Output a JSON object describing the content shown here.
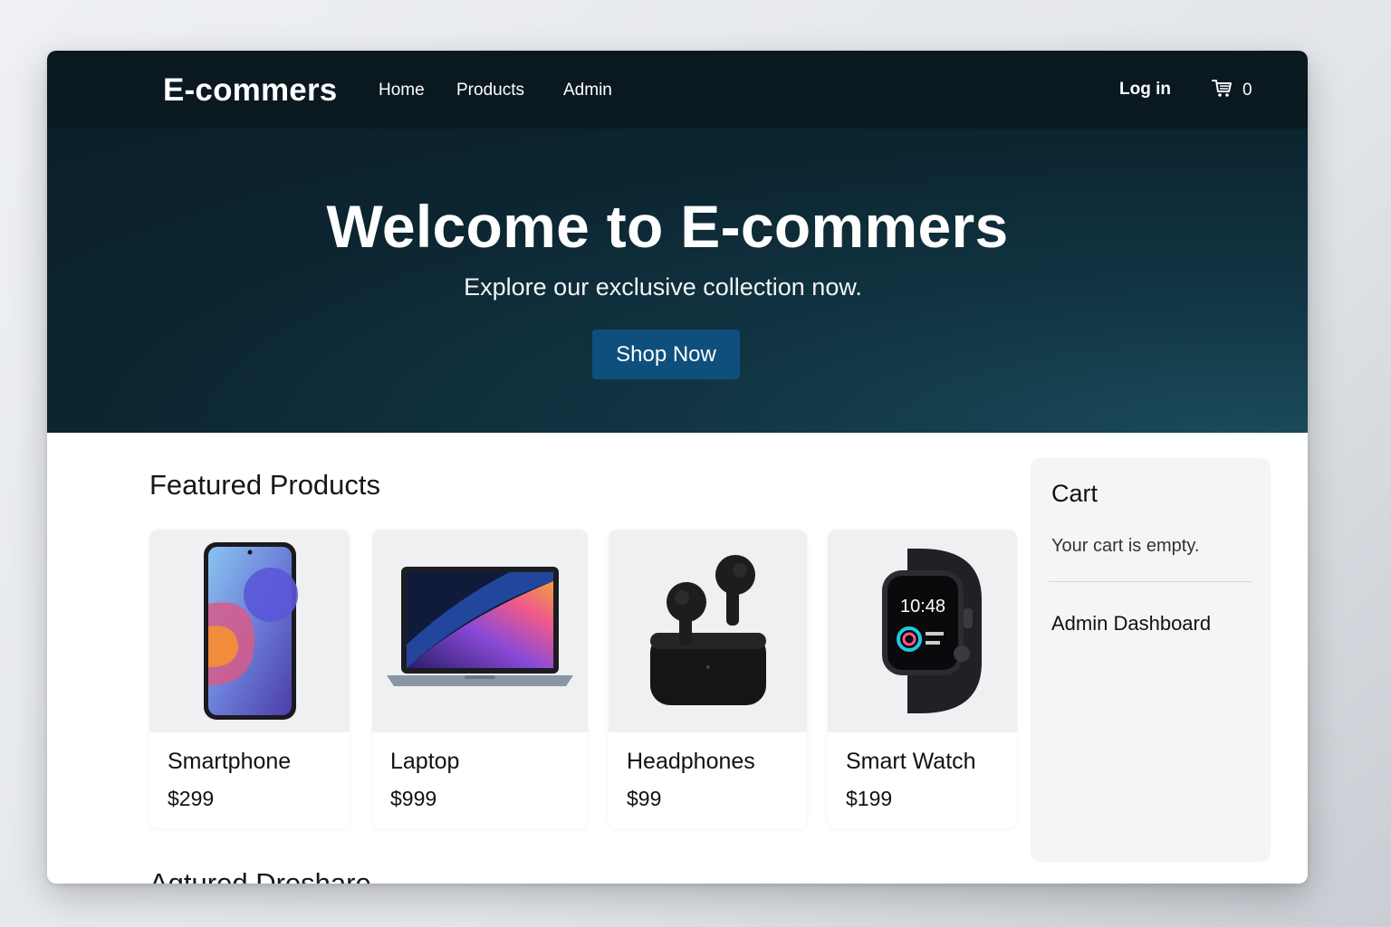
{
  "nav": {
    "brand": "E-commers",
    "links": [
      "Home",
      "Products",
      "Admin"
    ],
    "login": "Log in",
    "cart_count": "0"
  },
  "hero": {
    "title": "Welcome to E-commers",
    "subtitle": "Explore our exclusive collection now.",
    "cta": "Shop Now"
  },
  "featured": {
    "title": "Featured Products",
    "products": [
      {
        "name": "Smartphone",
        "price": "$299",
        "icon": "smartphone-image"
      },
      {
        "name": "Laptop",
        "price": "$999",
        "icon": "laptop-image"
      },
      {
        "name": "Headphones",
        "price": "$99",
        "icon": "earbuds-image"
      },
      {
        "name": "Smart Watch",
        "price": "$199",
        "icon": "smartwatch-image",
        "screen_time": "10:48"
      }
    ]
  },
  "cart": {
    "title": "Cart",
    "empty": "Your cart is empty.",
    "admin_link": "Admin Dashboard"
  },
  "section2_title": "Aqtured Dreshare",
  "colors": {
    "navbar": "#0a1820",
    "hero": "#0c2530",
    "accent": "#0f4f7d",
    "card_bg": "#eef0f2"
  }
}
